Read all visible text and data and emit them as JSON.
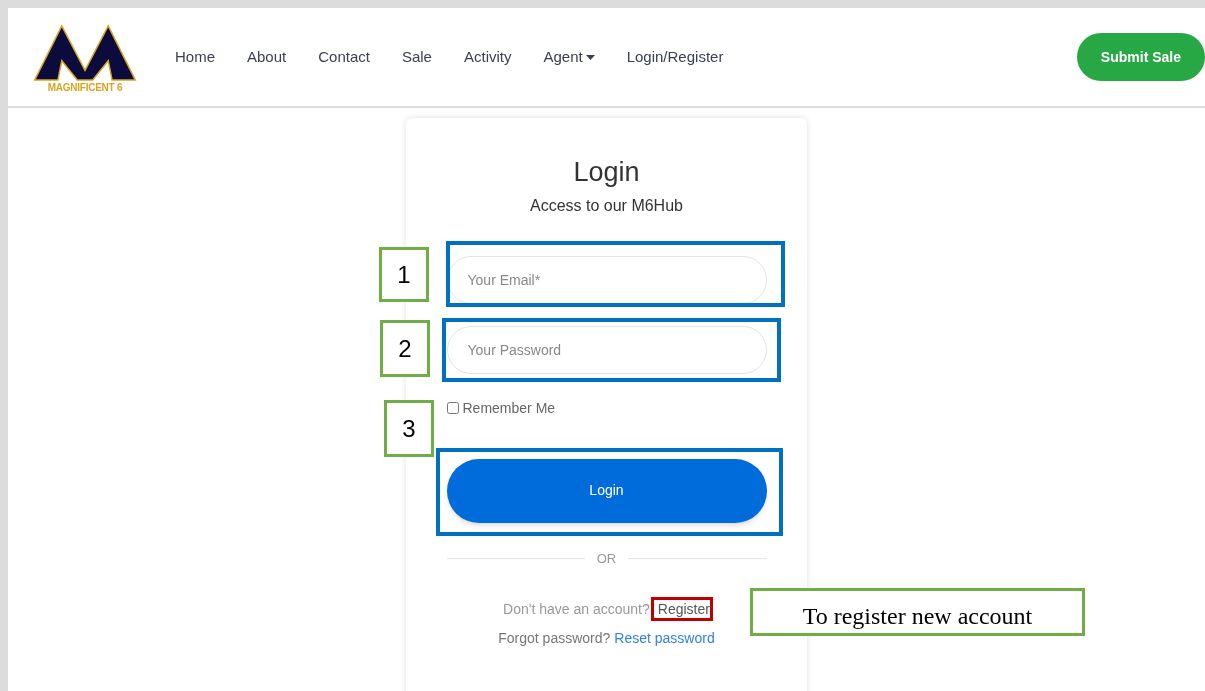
{
  "logo": {
    "text": "MAGNIFICENT 6"
  },
  "nav": [
    {
      "label": "Home",
      "kind": "link"
    },
    {
      "label": "About",
      "kind": "link"
    },
    {
      "label": "Contact",
      "kind": "link"
    },
    {
      "label": "Sale",
      "kind": "link"
    },
    {
      "label": "Activity",
      "kind": "link"
    },
    {
      "label": "Agent",
      "kind": "dropdown"
    },
    {
      "label": "Login/Register",
      "kind": "link"
    }
  ],
  "submit_button": "Submit Sale",
  "login_card": {
    "title": "Login",
    "subtitle": "Access to our M6Hub",
    "email": {
      "placeholder": "Your Email*"
    },
    "password": {
      "placeholder": "Your Password"
    },
    "remember": {
      "label": "Remember Me",
      "checked": false
    },
    "login_button": "Login",
    "divider": "OR",
    "register_prompt": "Don't have an account?",
    "register_link": "Register",
    "forgot_prompt": "Forgot password?",
    "reset_link": "Reset password"
  },
  "annotations": [
    {
      "kind": "number",
      "text": "1",
      "color": "#70ad47"
    },
    {
      "kind": "frame",
      "color": "#0070c0"
    },
    {
      "kind": "number",
      "text": "2",
      "color": "#70ad47"
    },
    {
      "kind": "frame",
      "color": "#0070c0"
    },
    {
      "kind": "number",
      "text": "3",
      "color": "#70ad47"
    },
    {
      "kind": "frame",
      "color": "#0070c0"
    },
    {
      "kind": "frame",
      "color": "#c00000"
    },
    {
      "kind": "callout",
      "text": "To register new account",
      "color": "#70ad47"
    }
  ]
}
